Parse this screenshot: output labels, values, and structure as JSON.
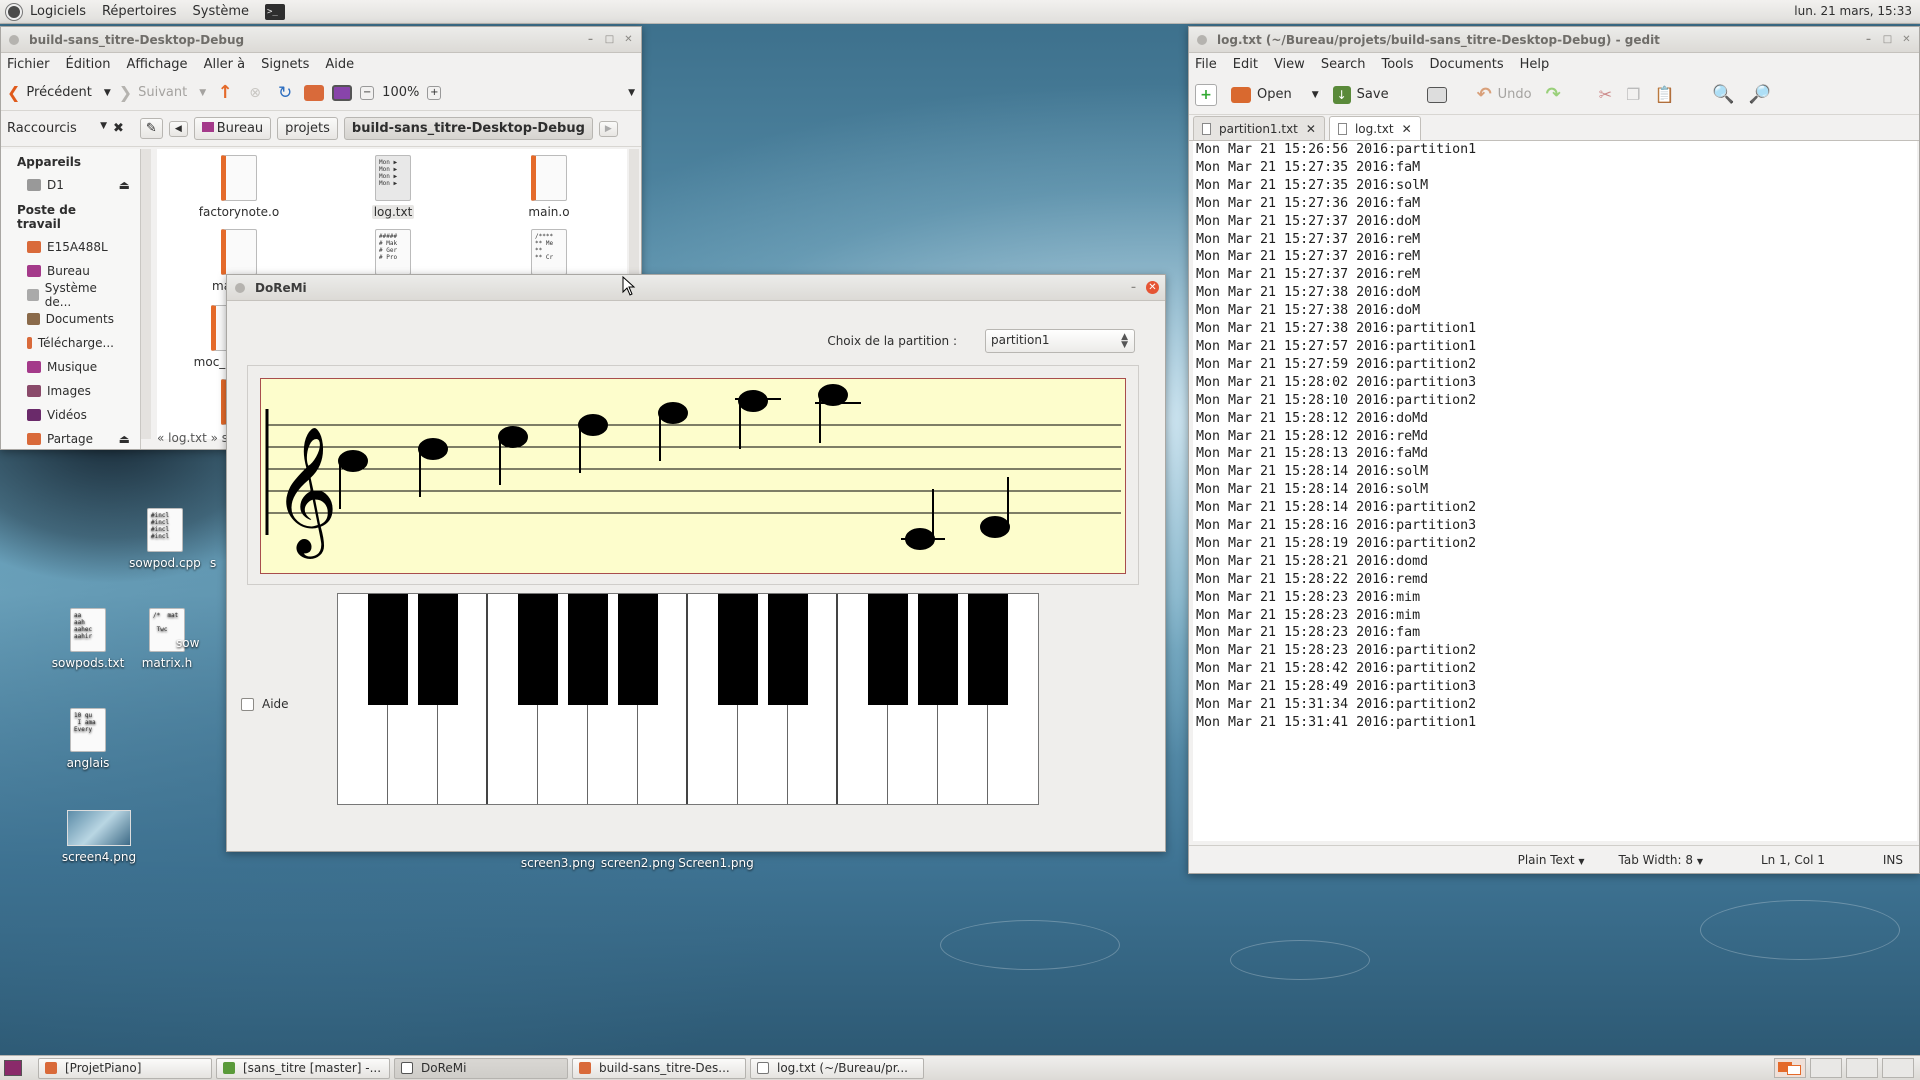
{
  "top_panel": {
    "menus": [
      "Logiciels",
      "Répertoires",
      "Système"
    ],
    "clock": "lun. 21 mars, 15:33"
  },
  "nautilus": {
    "title": "build-sans_titre-Desktop-Debug",
    "menus": [
      "Fichier",
      "Édition",
      "Affichage",
      "Aller à",
      "Signets",
      "Aide"
    ],
    "back_label": "Précédent",
    "forward_label": "Suivant",
    "zoom": "100%",
    "shortcuts_label": "Raccourcis",
    "breadcrumbs": [
      "Bureau",
      "projets",
      "build-sans_titre-Desktop-Debug"
    ],
    "sidebar": {
      "devices_header": "Appareils",
      "devices": [
        "D1"
      ],
      "workspace_header": "Poste de travail",
      "places": [
        "E15A488L",
        "Bureau",
        "Système de...",
        "Documents",
        "Télécharge...",
        "Musique",
        "Images",
        "Vidéos",
        "Partage"
      ]
    },
    "files": [
      {
        "name": "factorynote.o",
        "preview": ""
      },
      {
        "name": "log.txt",
        "preview": "Mon ▶\nMon ▶\nMon ▶\nMon ▶"
      },
      {
        "name": "main.o",
        "preview": ""
      },
      {
        "name": "main",
        "preview": ""
      },
      {
        "name": "",
        "preview": "#####\n# Mak\n# Ger\n# Pro"
      },
      {
        "name": "",
        "preview": "/****\n** Me\n**\n** Cr"
      },
      {
        "name": "moc_ma",
        "preview": ""
      }
    ],
    "status_crumb": "« log.txt » s"
  },
  "doremi": {
    "title": "DoReMi",
    "choix_label": "Choix de la partition :",
    "selected_partition": "partition1",
    "aide_label": "Aide"
  },
  "gedit": {
    "title": "log.txt (~/Bureau/projets/build-sans_titre-Desktop-Debug) - gedit",
    "menus": [
      "File",
      "Edit",
      "View",
      "Search",
      "Tools",
      "Documents",
      "Help"
    ],
    "toolbar": {
      "open": "Open",
      "save": "Save",
      "undo": "Undo"
    },
    "tabs": [
      "partition1.txt",
      "log.txt"
    ],
    "lines": [
      "Mon Mar 21 15:26:56 2016:partition1",
      "Mon Mar 21 15:27:35 2016:faM",
      "Mon Mar 21 15:27:35 2016:solM",
      "Mon Mar 21 15:27:36 2016:faM",
      "Mon Mar 21 15:27:37 2016:doM",
      "Mon Mar 21 15:27:37 2016:reM",
      "Mon Mar 21 15:27:37 2016:reM",
      "Mon Mar 21 15:27:37 2016:reM",
      "Mon Mar 21 15:27:38 2016:doM",
      "Mon Mar 21 15:27:38 2016:doM",
      "Mon Mar 21 15:27:38 2016:partition1",
      "Mon Mar 21 15:27:57 2016:partition1",
      "Mon Mar 21 15:27:59 2016:partition2",
      "Mon Mar 21 15:28:02 2016:partition3",
      "Mon Mar 21 15:28:10 2016:partition2",
      "Mon Mar 21 15:28:12 2016:doMd",
      "Mon Mar 21 15:28:12 2016:reMd",
      "Mon Mar 21 15:28:13 2016:faMd",
      "Mon Mar 21 15:28:14 2016:solM",
      "Mon Mar 21 15:28:14 2016:solM",
      "Mon Mar 21 15:28:14 2016:partition2",
      "Mon Mar 21 15:28:16 2016:partition3",
      "Mon Mar 21 15:28:19 2016:partition2",
      "Mon Mar 21 15:28:21 2016:domd",
      "Mon Mar 21 15:28:22 2016:remd",
      "Mon Mar 21 15:28:23 2016:mim",
      "Mon Mar 21 15:28:23 2016:mim",
      "Mon Mar 21 15:28:23 2016:fam",
      "Mon Mar 21 15:28:23 2016:partition2",
      "Mon Mar 21 15:28:42 2016:partition2",
      "Mon Mar 21 15:28:49 2016:partition3",
      "Mon Mar 21 15:31:34 2016:partition2",
      "Mon Mar 21 15:31:41 2016:partition1"
    ],
    "status": {
      "lang": "Plain Text",
      "tab_width": "Tab Width: 8",
      "position": "Ln 1, Col 1",
      "mode": "INS"
    }
  },
  "desktop_icons": [
    {
      "name": "sowpod.cpp",
      "preview": "#incl\n#incl\n#incl\n#incl"
    },
    {
      "name": "sowpods.txt",
      "preview": "aa\naah\naahec\naahir"
    },
    {
      "name": "matrix.h",
      "preview": "/*  mat\n\n Twc"
    },
    {
      "name": "anglais",
      "preview": "10 qu\n I ama\nEvery"
    },
    {
      "name": "screen4.png",
      "preview": ""
    },
    {
      "name": "screen3.png",
      "preview": ""
    },
    {
      "name": "screen2.png",
      "preview": ""
    },
    {
      "name": "Screen1.png",
      "preview": ""
    },
    {
      "name": "sow",
      "preview": ""
    },
    {
      "name": "s",
      "preview": ""
    }
  ],
  "taskbar": [
    "[ProjetPiano]",
    "[sans_titre [master] -...",
    "DoReMi",
    "build-sans_titre-Des...",
    "log.txt (~/Bureau/pr..."
  ]
}
